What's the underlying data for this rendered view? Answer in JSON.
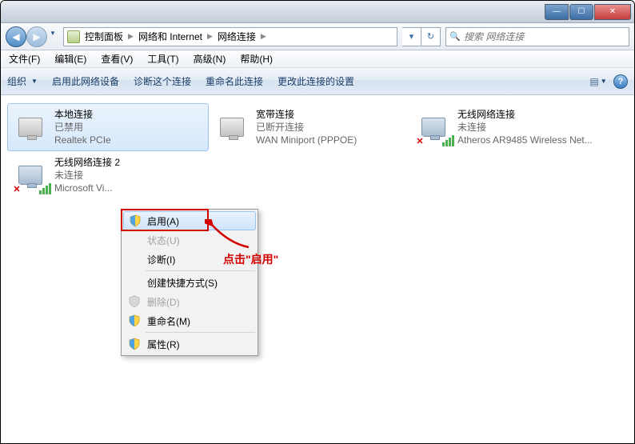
{
  "window_controls": {
    "min": "—",
    "max": "☐",
    "close": "✕"
  },
  "breadcrumb": {
    "items": [
      "控制面板",
      "网络和 Internet",
      "网络连接"
    ]
  },
  "search": {
    "placeholder": "搜索 网络连接"
  },
  "menubar": {
    "items": [
      "文件(F)",
      "编辑(E)",
      "查看(V)",
      "工具(T)",
      "高级(N)",
      "帮助(H)"
    ]
  },
  "cmdbar": {
    "organize": "组织",
    "items": [
      "启用此网络设备",
      "诊断这个连接",
      "重命名此连接",
      "更改此连接的设置"
    ]
  },
  "connections": [
    {
      "name": "本地连接",
      "status": "已禁用",
      "device": "Realtek PCIe"
    },
    {
      "name": "宽带连接",
      "status": "已断开连接",
      "device": "WAN Miniport (PPPOE)"
    },
    {
      "name": "无线网络连接",
      "status": "未连接",
      "device": "Atheros AR9485 Wireless Net..."
    },
    {
      "name": "无线网络连接 2",
      "status": "未连接",
      "device": "Microsoft Vi..."
    }
  ],
  "context_menu": {
    "items": [
      {
        "label": "启用(A)",
        "shield": true,
        "highlighted": true
      },
      {
        "label": "状态(U)",
        "disabled": true
      },
      {
        "label": "诊断(I)"
      },
      {
        "sep": true
      },
      {
        "label": "创建快捷方式(S)"
      },
      {
        "label": "删除(D)",
        "disabled": true,
        "shield": true
      },
      {
        "label": "重命名(M)",
        "shield": true
      },
      {
        "sep": true
      },
      {
        "label": "属性(R)",
        "shield": true
      }
    ]
  },
  "annotation": "点击\"启用\""
}
